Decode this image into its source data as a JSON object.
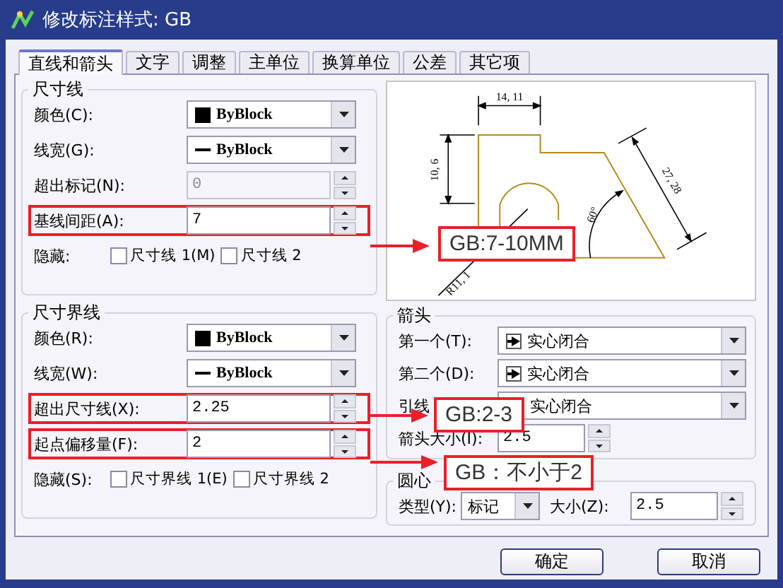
{
  "window": {
    "title": "修改标注样式: GB"
  },
  "tabs": [
    {
      "label": "直线和箭头",
      "selected": true
    },
    {
      "label": "文字",
      "selected": false
    },
    {
      "label": "调整",
      "selected": false
    },
    {
      "label": "主单位",
      "selected": false
    },
    {
      "label": "换算单位",
      "selected": false
    },
    {
      "label": "公差",
      "selected": false
    },
    {
      "label": "其它项",
      "selected": false
    }
  ],
  "dimension_lines": {
    "title": "尺寸线",
    "rows": [
      {
        "kind": "combo",
        "label": "颜色(C):",
        "value": "ByBlock",
        "color": "#000000"
      },
      {
        "kind": "combo",
        "label": "线宽(G):",
        "value": "ByBlock"
      },
      {
        "kind": "spin",
        "label": "超出标记(N):",
        "value": "0",
        "disabled": true,
        "highlighted": false
      },
      {
        "kind": "spin",
        "label": "基线间距(A):",
        "value": "7",
        "disabled": false,
        "highlighted": true
      },
      {
        "kind": "checks",
        "label": "隐藏:",
        "options": [
          {
            "label": "尺寸线 1(M)",
            "checked": false
          },
          {
            "label": "尺寸线 2",
            "checked": false
          }
        ]
      }
    ]
  },
  "extension_lines": {
    "title": "尺寸界线",
    "rows": [
      {
        "kind": "combo",
        "label": "颜色(R):",
        "value": "ByBlock",
        "color": "#000000"
      },
      {
        "kind": "combo",
        "label": "线宽(W):",
        "value": "ByBlock"
      },
      {
        "kind": "spin",
        "label": "超出尺寸线(X):",
        "value": "2.25",
        "disabled": false,
        "highlighted": true
      },
      {
        "kind": "spin",
        "label": "起点偏移量(F):",
        "value": "2",
        "disabled": false,
        "highlighted": true
      },
      {
        "kind": "checks",
        "label": "隐藏(S):",
        "options": [
          {
            "label": "尺寸界线 1(E)",
            "checked": false
          },
          {
            "label": "尺寸界线 2",
            "checked": false
          }
        ]
      }
    ]
  },
  "preview": {
    "labels": [
      "14, 11",
      "10, 6",
      "27, 28",
      "60°",
      "R11, 1"
    ]
  },
  "arrowheads": {
    "title": "箭头",
    "rows": [
      {
        "kind": "combo",
        "label": "第一个(T):",
        "value": "实心闭合",
        "arrow_icon": true
      },
      {
        "kind": "combo",
        "label": "第二个(D):",
        "value": "实心闭合",
        "arrow_icon": true
      },
      {
        "kind": "combo",
        "label": "引线",
        "value": "实心闭合",
        "arrow_icon": false
      },
      {
        "kind": "spin",
        "label": "箭头大小(I):",
        "value": "2.5",
        "disabled": false,
        "highlighted": false
      }
    ]
  },
  "center_marks": {
    "title": "圆心",
    "type_label": "类型(Y):",
    "type_value": "标记",
    "size_label": "大小(Z):",
    "size_value": "2.5"
  },
  "buttons": [
    "确定",
    "取消"
  ],
  "callouts": [
    {
      "text": "GB:7-10MM"
    },
    {
      "text": "GB:2-3"
    },
    {
      "text": "GB：不小于2"
    }
  ]
}
